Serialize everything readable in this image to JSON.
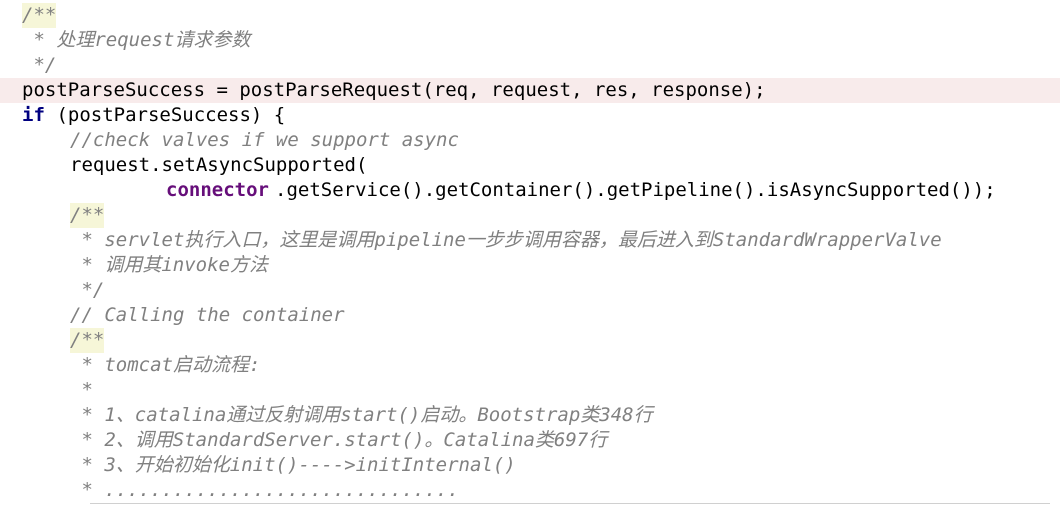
{
  "code": {
    "lines": [
      {
        "id": "l0",
        "text": "/**",
        "indent": 22
      },
      {
        "id": "l1",
        "text": " * 处理request请求参数",
        "indent": 22
      },
      {
        "id": "l2",
        "text": " */",
        "indent": 22
      },
      {
        "id": "l3",
        "text": "postParseSuccess = postParseRequest(req, request, res, response);",
        "indent": 22
      },
      {
        "id": "l4_kw",
        "text": "if",
        "indent": 22
      },
      {
        "id": "l4_rest",
        "text": " (postParseSuccess) {"
      },
      {
        "id": "l5",
        "text": "//check valves if we support async"
      },
      {
        "id": "l6",
        "text": "request.setAsyncSupported("
      },
      {
        "id": "l7_fld",
        "text": "connector"
      },
      {
        "id": "l7_rest",
        "text": ".getService().getContainer().getPipeline().isAsyncSupported());"
      },
      {
        "id": "l8",
        "text": "/**"
      },
      {
        "id": "l9",
        "text": " * servlet执行入口，这里是调用pipeline一步步调用容器，最后进入到StandardWrapperValve"
      },
      {
        "id": "l10",
        "text": " * 调用其invoke方法"
      },
      {
        "id": "l11",
        "text": " */"
      },
      {
        "id": "l12",
        "text": "// Calling the container"
      },
      {
        "id": "l13",
        "text": "/**"
      },
      {
        "id": "l14",
        "text": " * tomcat启动流程:"
      },
      {
        "id": "l15",
        "text": " *"
      },
      {
        "id": "l16",
        "text": " * 1、catalina通过反射调用start()启动。Bootstrap类348行"
      },
      {
        "id": "l17",
        "text": " * 2、调用StandardServer.start()。Catalina类697行"
      },
      {
        "id": "l18",
        "text": " * 3、开始初始化init()---->initInternal()"
      },
      {
        "id": "l19",
        "text": " * ..............................."
      }
    ]
  },
  "colors": {
    "comment": "#808080",
    "keyword": "#000080",
    "field": "#660e7a",
    "highlight_line": "#f8ebeb",
    "doc_start_bg": "#f6f6d8"
  }
}
